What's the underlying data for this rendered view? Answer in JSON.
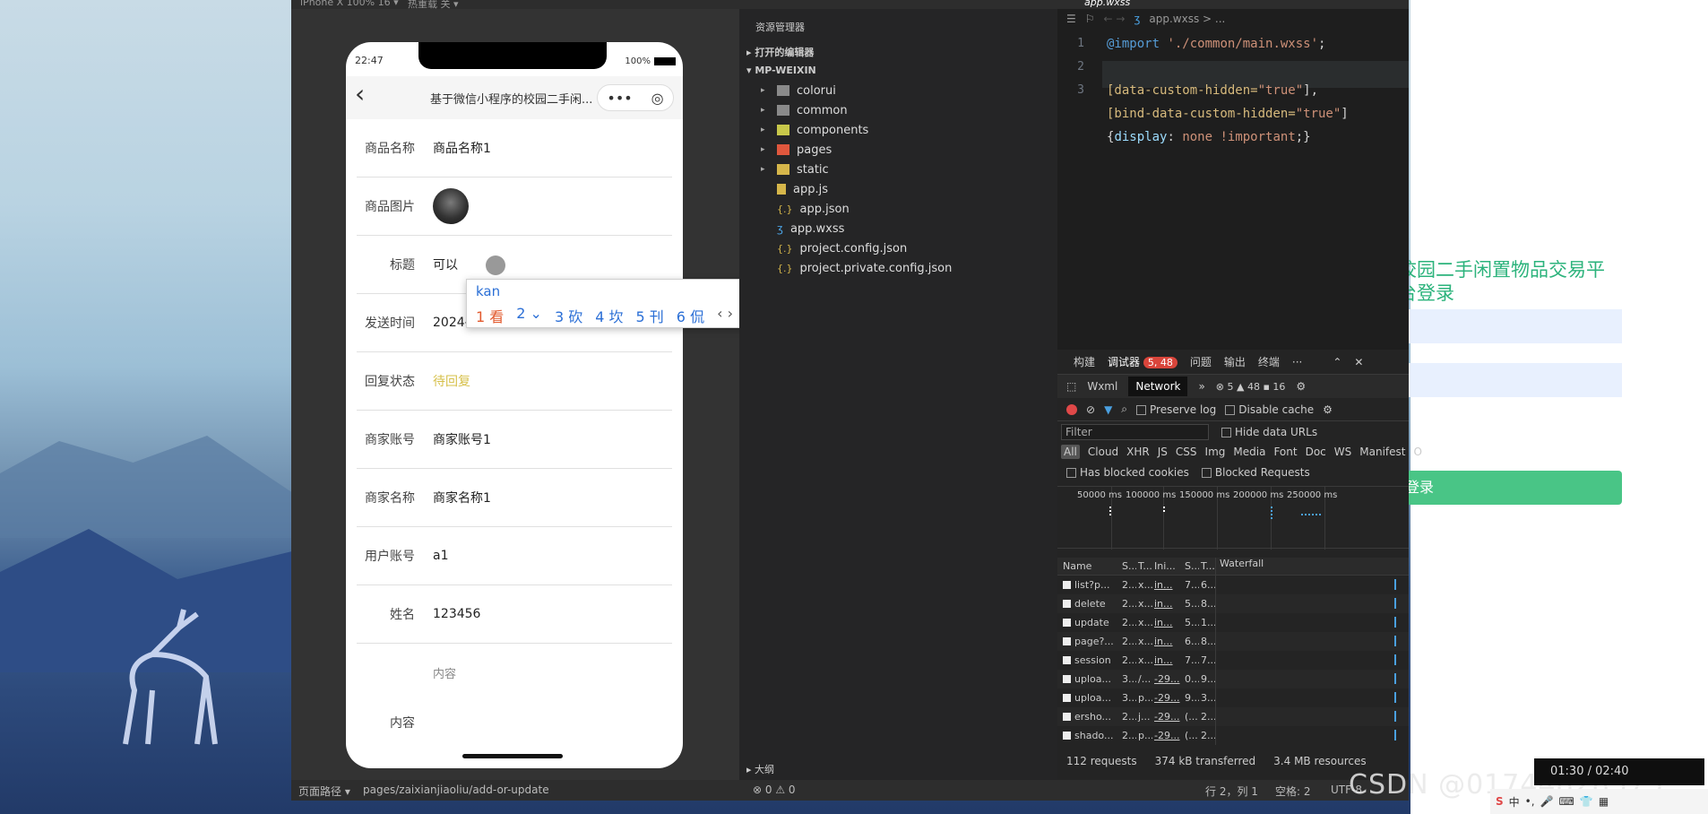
{
  "topbar": {
    "device": "iPhone X 100% 16 ▾",
    "hotreload": "热重载 关 ▾"
  },
  "phone": {
    "time": "22:47",
    "battery": "100%",
    "nav_title": "基于微信小程序的校园二手闲...",
    "capsule_more": "•••",
    "capsule_close": "◎",
    "back": "‹",
    "rows": [
      {
        "label": "商品名称",
        "value": "商品名称1"
      },
      {
        "label": "商品图片",
        "value": ""
      },
      {
        "label": "标题",
        "value": "可以"
      },
      {
        "label": "发送时间",
        "value": "2024-02-28 22:47:49"
      },
      {
        "label": "回复状态",
        "value": "待回复"
      },
      {
        "label": "商家账号",
        "value": "商家账号1"
      },
      {
        "label": "商家名称",
        "value": "商家名称1"
      },
      {
        "label": "用户账号",
        "value": "a1"
      },
      {
        "label": "姓名",
        "value": "123456"
      },
      {
        "label": "",
        "value": "内容"
      },
      {
        "label": "内容",
        "value": ""
      }
    ]
  },
  "ime": {
    "composition": "kan",
    "candidates": [
      "1 看",
      "2 ⌄",
      "3 砍",
      "4 坎",
      "5 刊",
      "6 侃"
    ],
    "arrows": "‹ › ⌄"
  },
  "explorer": {
    "title": "资源管理器",
    "open_editors": "▸ 打开的编辑器",
    "project": "▾ MP-WEIXIN",
    "items": [
      {
        "name": "colorui",
        "type": "folder",
        "color": "#8a8a8a"
      },
      {
        "name": "common",
        "type": "folder",
        "color": "#8a8a8a"
      },
      {
        "name": "components",
        "type": "folder",
        "color": "#c8c84a"
      },
      {
        "name": "pages",
        "type": "folder",
        "color": "#e0573d"
      },
      {
        "name": "static",
        "type": "folder",
        "color": "#d6b64a"
      },
      {
        "name": "app.js",
        "type": "file",
        "color": "#d6b64a"
      },
      {
        "name": "app.json",
        "type": "file",
        "color": "#d6b64a"
      },
      {
        "name": "app.wxss",
        "type": "file",
        "color": "#4aa0e0"
      },
      {
        "name": "project.config.json",
        "type": "file",
        "color": "#d6b64a"
      },
      {
        "name": "project.private.config.json",
        "type": "file",
        "color": "#d6b64a"
      }
    ],
    "outline": "▸ 大纲"
  },
  "editor": {
    "tab": "app.wxss",
    "breadcrumb": "app.wxss > ...",
    "lines": [
      {
        "n": "1",
        "parts": [
          {
            "t": "@import ",
            "c": "#569cd6"
          },
          {
            "t": "'./common/main.wxss'",
            "c": "#ce9178"
          },
          {
            "t": ";",
            "c": "#d4d4d4"
          }
        ]
      },
      {
        "n": "2",
        "parts": []
      },
      {
        "n": "3",
        "parts": [
          {
            "t": "[data-custom-hidden=",
            "c": "#d7ba7d"
          },
          {
            "t": "\"true\"",
            "c": "#ce9178"
          },
          {
            "t": "],",
            "c": "#d4d4d4"
          }
        ]
      },
      {
        "n": "",
        "parts": [
          {
            "t": "[bind-data-custom-hidden=",
            "c": "#d7ba7d"
          },
          {
            "t": "\"true\"",
            "c": "#ce9178"
          },
          {
            "t": "]",
            "c": "#d4d4d4"
          }
        ]
      },
      {
        "n": "",
        "parts": [
          {
            "t": "{",
            "c": "#d4d4d4"
          },
          {
            "t": "display",
            "c": "#9cdcfe"
          },
          {
            "t": ": ",
            "c": "#d4d4d4"
          },
          {
            "t": "none !important",
            "c": "#ce9178"
          },
          {
            "t": ";}",
            "c": "#d4d4d4"
          }
        ]
      }
    ]
  },
  "devtools": {
    "tabs": [
      "构建",
      "调试器",
      "问题",
      "输出",
      "终端",
      "···"
    ],
    "debug_badge": "5, 48",
    "subtabs": [
      "Wxml",
      "Network",
      "»"
    ],
    "counts": "⊗ 5  ▲ 48  ▪ 16",
    "preserve_log": "Preserve log",
    "disable_cache": "Disable cache",
    "filter_placeholder": "Filter",
    "hide_data_urls": "Hide data URLs",
    "types": [
      "All",
      "Cloud",
      "XHR",
      "JS",
      "CSS",
      "Img",
      "Media",
      "Font",
      "Doc",
      "WS",
      "Manifest",
      "O"
    ],
    "has_blocked": "Has blocked cookies",
    "blocked_requests": "Blocked Requests",
    "timeline": [
      "50000 ms",
      "100000 ms",
      "150000 ms",
      "200000 ms",
      "250000 ms"
    ],
    "columns": [
      "Name",
      "S...",
      "T...",
      "Ini...",
      "S...",
      "T...",
      "Waterfall"
    ],
    "rows": [
      [
        "list?p...",
        "2...",
        "x...",
        "in...",
        "7...",
        "6..."
      ],
      [
        "delete",
        "2...",
        "x...",
        "in...",
        "5...",
        "8..."
      ],
      [
        "update",
        "2...",
        "x...",
        "in...",
        "5...",
        "1..."
      ],
      [
        "page?...",
        "2...",
        "x...",
        "in...",
        "6...",
        "8..."
      ],
      [
        "session",
        "2...",
        "x...",
        "in...",
        "7...",
        "7..."
      ],
      [
        "uploa...",
        "3...",
        "/...",
        "-29...",
        "0...",
        "9..."
      ],
      [
        "uploa...",
        "3...",
        "p...",
        "-29...",
        "9...",
        "3..."
      ],
      [
        "ersho...",
        "2...",
        "j...",
        "-29...",
        "(...",
        "2..."
      ],
      [
        "shado...",
        "2...",
        "p...",
        "-29...",
        "(...",
        "2..."
      ]
    ],
    "summary": [
      "112 requests",
      "374 kB transferred",
      "3.4 MB resources"
    ]
  },
  "statusbar": {
    "left": "页面路径 ▾",
    "path": "pages/zaixianjiaoliu/add-or-update",
    "errors": "⊗ 0 ⚠ 0",
    "pos": "行 2，列 1",
    "spaces": "空格: 2",
    "enc": "UTF-8"
  },
  "login": {
    "title1": "校园二手闲置物品交易平",
    "title2": "台登录",
    "button": "登录"
  },
  "watermark": "CSDN @01744828575",
  "clock": "01:30 / 02:40"
}
